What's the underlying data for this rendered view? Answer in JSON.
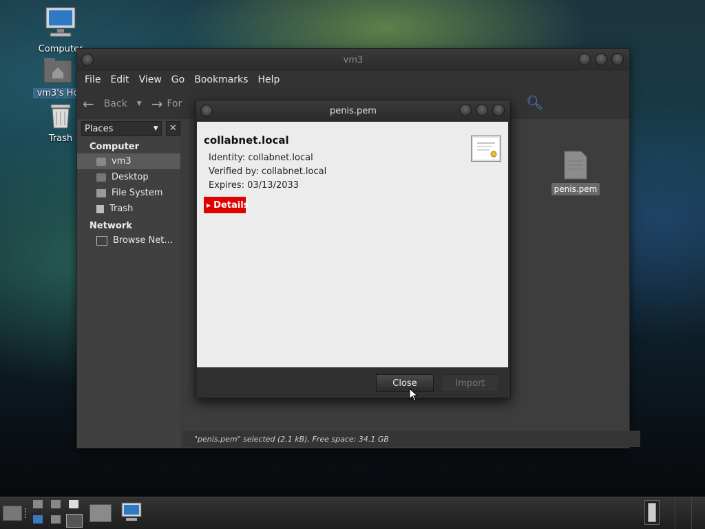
{
  "desktop": {
    "icons": [
      {
        "label": "Computer",
        "icon": "computer-icon"
      },
      {
        "label": "vm3's Ho",
        "icon": "home-folder-icon"
      },
      {
        "label": "Trash",
        "icon": "trash-icon"
      }
    ]
  },
  "file_manager": {
    "title": "vm3",
    "menu": [
      "File",
      "Edit",
      "View",
      "Go",
      "Bookmarks",
      "Help"
    ],
    "toolbar": {
      "back_label": "Back",
      "forward_label": "For"
    },
    "sidebar": {
      "selector_label": "Places",
      "sections": [
        {
          "heading": "Computer",
          "items": [
            "vm3",
            "Desktop",
            "File System",
            "Trash"
          ]
        },
        {
          "heading": "Network",
          "items": [
            "Browse Net…"
          ]
        }
      ],
      "selected_item": "vm3"
    },
    "files": [
      {
        "name": "penis.pem",
        "icon": "document-icon"
      }
    ],
    "status": "\"penis.pem\" selected (2.1 kB), Free space: 34.1 GB"
  },
  "dialog": {
    "title": "penis.pem",
    "cert_name": "collabnet.local",
    "identity": "Identity: collabnet.local",
    "verified_by": "Verified by: collabnet.local",
    "expires": "Expires: 03/13/2033",
    "details_label": "Details",
    "close_label": "Close",
    "import_label": "Import",
    "accent_color": "#e00000"
  }
}
